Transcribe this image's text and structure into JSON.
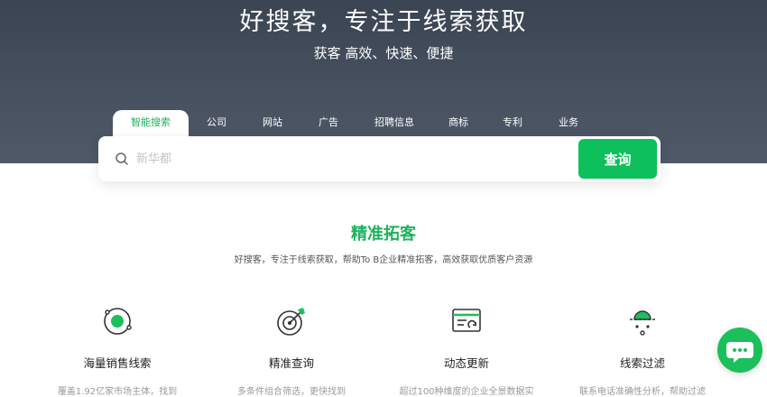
{
  "hero": {
    "title": "好搜客，专注于线索获取",
    "subtitle": "获客 高效、快速、便捷"
  },
  "tabs": [
    {
      "label": "智能搜索",
      "active": true
    },
    {
      "label": "公司"
    },
    {
      "label": "网站"
    },
    {
      "label": "广告"
    },
    {
      "label": "招聘信息"
    },
    {
      "label": "商标"
    },
    {
      "label": "专利"
    },
    {
      "label": "业务"
    }
  ],
  "search": {
    "placeholder": "新华都",
    "icon": "search-icon",
    "button_label": "查询"
  },
  "section": {
    "title": "精准拓客",
    "subtitle": "好搜客，专注于线索获取，帮助To B企业精准拓客，高效获取优质客户资源"
  },
  "features": [
    {
      "name": "海量销售线索",
      "desc": "覆盖1.92亿家市场主体，找到",
      "icon": "orbit-target-icon"
    },
    {
      "name": "精准查询",
      "desc": "多条件组合筛选，更快找到",
      "icon": "dartboard-icon"
    },
    {
      "name": "动态更新",
      "desc": "超过100种维度的企业全景数据实",
      "icon": "refresh-window-icon"
    },
    {
      "name": "线索过滤",
      "desc": "联系电话准确性分析，帮助过滤",
      "icon": "filter-dots-icon"
    }
  ],
  "colors": {
    "accent": "#1bb35b",
    "button": "#0dc05b",
    "hero_bg": "#3a4452"
  },
  "chat": {
    "icon": "chat-bubble-icon"
  }
}
